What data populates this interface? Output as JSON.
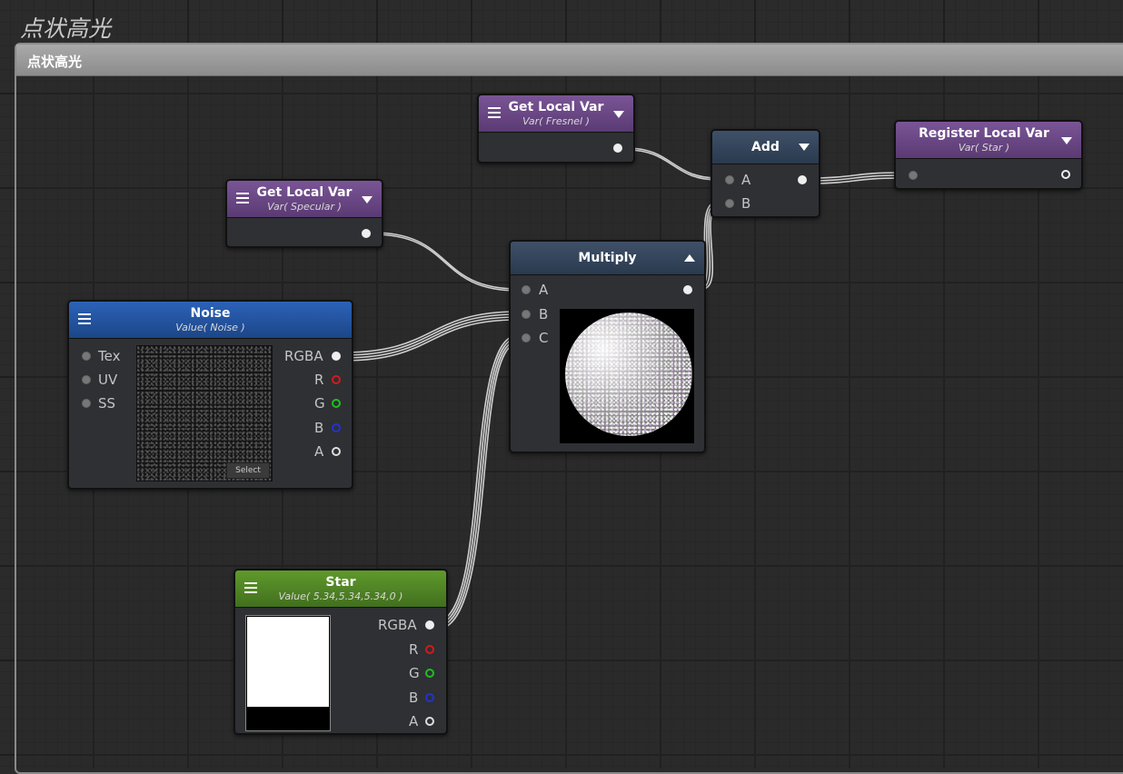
{
  "group": {
    "title_outer": "点状高光",
    "title_bar": "点状高光"
  },
  "nodes": {
    "get_fresnel": {
      "title": "Get Local Var",
      "subtitle": "Var( Fresnel )"
    },
    "get_specular": {
      "title": "Get Local Var",
      "subtitle": "Var( Specular )"
    },
    "add": {
      "title": "Add",
      "in_a": "A",
      "in_b": "B"
    },
    "register": {
      "title": "Register Local Var",
      "subtitle": "Var( Star )"
    },
    "multiply": {
      "title": "Multiply",
      "in_a": "A",
      "in_b": "B",
      "in_c": "C"
    },
    "noise": {
      "title": "Noise",
      "subtitle": "Value( Noise )",
      "inputs": [
        "Tex",
        "UV",
        "SS"
      ],
      "outputs": [
        "RGBA",
        "R",
        "G",
        "B",
        "A"
      ],
      "select_label": "Select"
    },
    "star": {
      "title": "Star",
      "subtitle": "Value( 5.34,5.34,5.34,0 )",
      "outputs": [
        "RGBA",
        "R",
        "G",
        "B",
        "A"
      ]
    }
  },
  "colors": {
    "purple_header": "#6a4786",
    "blue_header": "#2457a3",
    "green_header": "#558a27",
    "slate_header": "#354760",
    "port_r": "#d21b1b",
    "port_g": "#1fbf1f",
    "port_b": "#2233cc"
  }
}
